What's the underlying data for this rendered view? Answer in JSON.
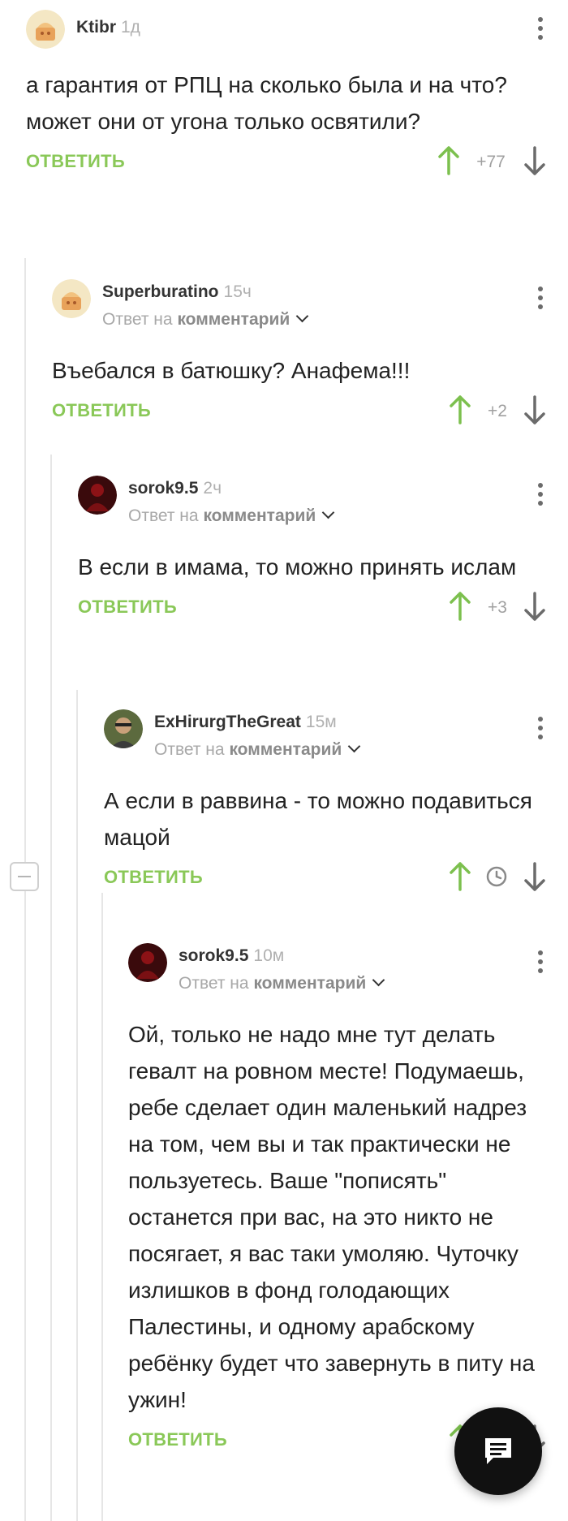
{
  "comments": [
    {
      "author": "Ktibr",
      "time": "1д",
      "text": "а гарантия от РПЦ на сколько была и на что?\nможет они  от угона только освятили?",
      "reply_label": "ОТВЕТИТЬ",
      "rating": "+77"
    },
    {
      "author": "Superburatino",
      "time": "15ч",
      "reply_to_prefix": "Ответ на",
      "reply_to_target": "комментарий",
      "text": "Въебался в батюшку? Анафема!!!",
      "reply_label": "ОТВЕТИТЬ",
      "rating": "+2"
    },
    {
      "author": "sorok9.5",
      "time": "2ч",
      "reply_to_prefix": "Ответ на",
      "reply_to_target": "комментарий",
      "text": "В если в имама, то можно принять ислам",
      "reply_label": "ОТВЕТИТЬ",
      "rating": "+3"
    },
    {
      "author": "ExHirurgTheGreat",
      "time": "15м",
      "reply_to_prefix": "Ответ на",
      "reply_to_target": "комментарий",
      "text": "А если в раввина - то можно подавиться мацой",
      "reply_label": "ОТВЕТИТЬ",
      "rating_state": "pending-clock-icon"
    },
    {
      "author": "sorok9.5",
      "time": "10м",
      "reply_to_prefix": "Ответ на",
      "reply_to_target": "комментарий",
      "text": "Ой, только не надо мне тут делать гевалт на ровном месте! Подумаешь, ребе сделает один маленький надрез на том, чем вы и так практически не пользуетесь. Ваше \"пописять\" останется при вас, на это никто не посягает, я вас таки умоляю. Чуточку излишков в фонд голодающих Палестины, и одному арабскому ребёнку будет что завернуть в питу на ужин!",
      "reply_label": "ОТВЕТИТЬ"
    }
  ],
  "colors": {
    "accent_green": "#8ac858",
    "vote_up": "#7cc04e",
    "vote_down": "#6b6b6b"
  },
  "icons": [
    "ellipsis-vertical-icon",
    "arrow-up-icon",
    "arrow-down-icon",
    "clock-icon",
    "collapse-minus-icon",
    "chat-bubble-icon",
    "chevron-down-icon"
  ]
}
